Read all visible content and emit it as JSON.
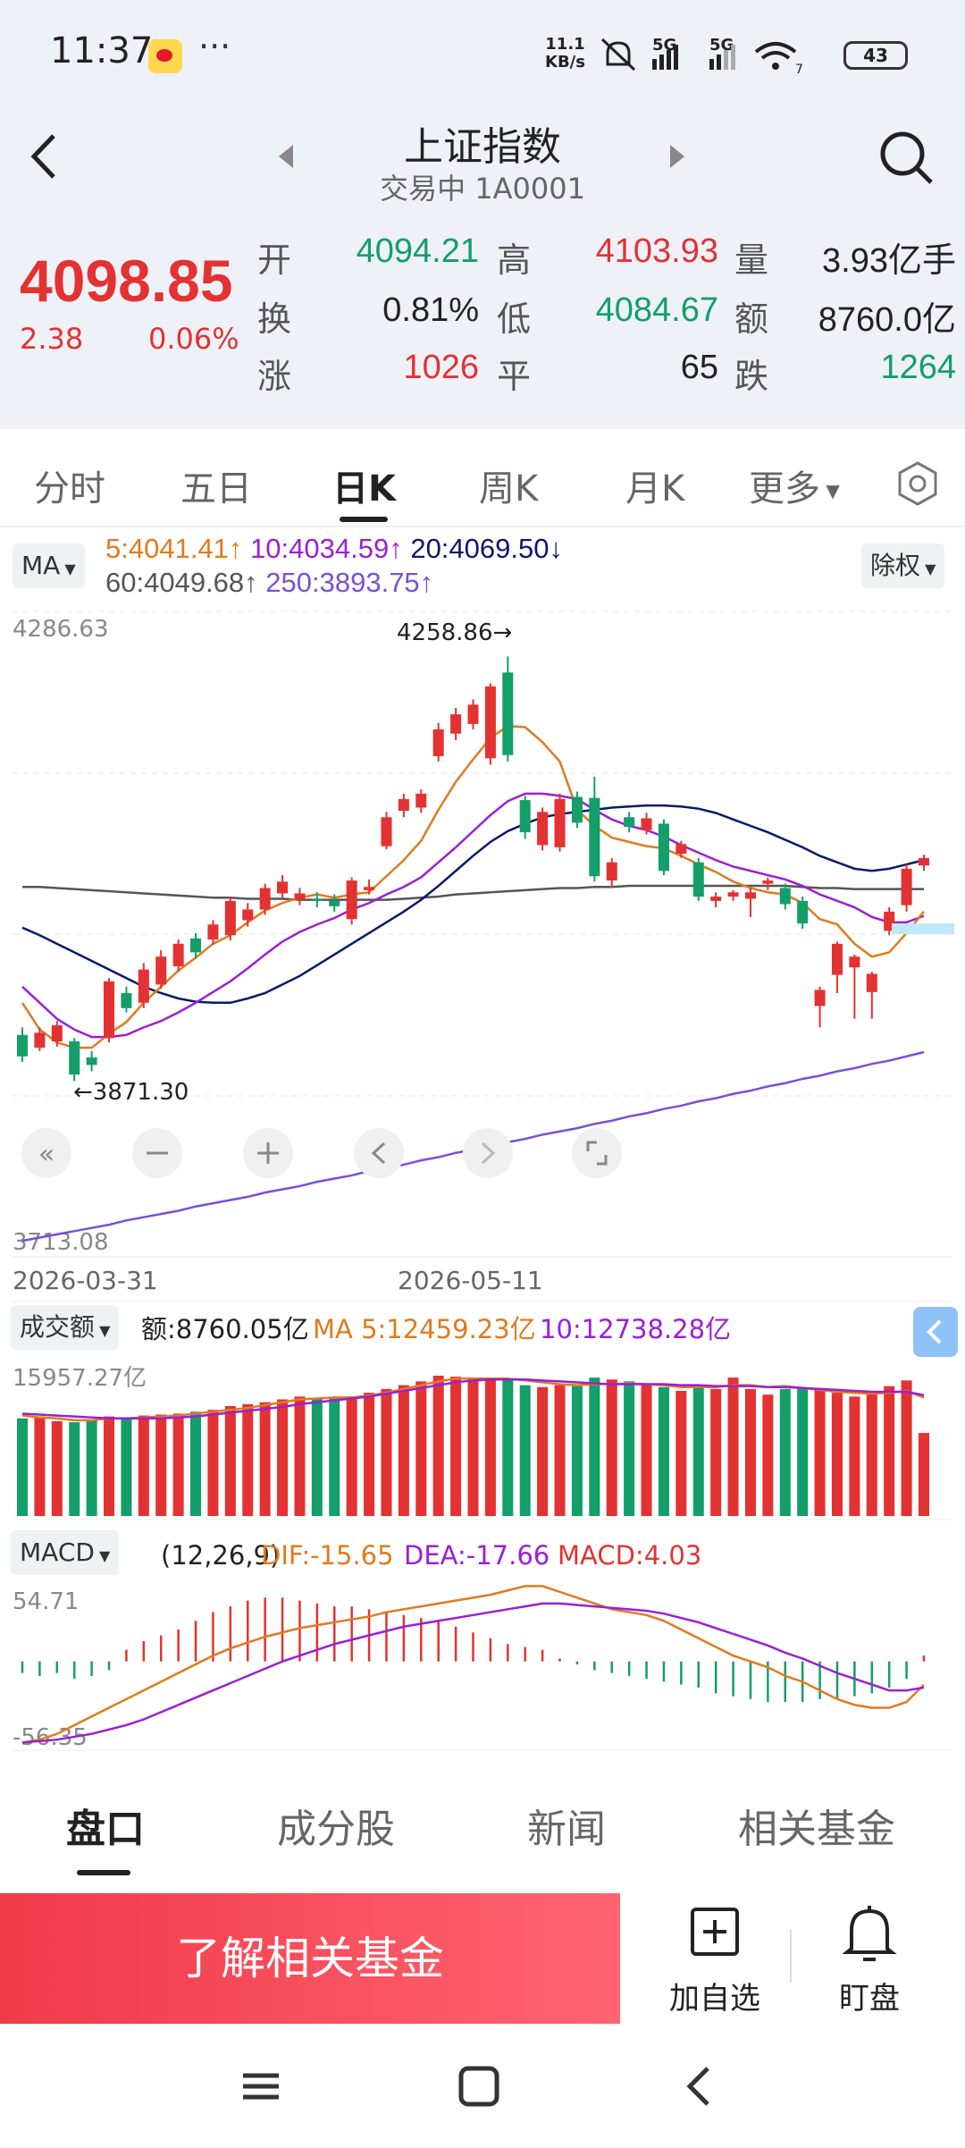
{
  "status": {
    "time": "11:37",
    "speed_top": "11.1",
    "speed_bottom": "KB/s",
    "net1": "5G",
    "net2": "5G",
    "wifi_sub": "7",
    "battery": "43",
    "more": "···"
  },
  "header": {
    "title": "上证指数",
    "subtitle": "交易中 1A0001"
  },
  "quote": {
    "price": "4098.85",
    "change": "2.38",
    "change_pct": "0.06%",
    "open_label": "开",
    "open": "4094.21",
    "high_label": "高",
    "high": "4103.93",
    "volume_label": "量",
    "volume": "3.93亿手",
    "turnover_label": "换",
    "turnover": "0.81%",
    "low_label": "低",
    "low": "4084.67",
    "amount_label": "额",
    "amount": "8760.0亿",
    "up_label": "涨",
    "up": "1026",
    "flat_label": "平",
    "flat": "65",
    "down_label": "跌",
    "down": "1264"
  },
  "period_tabs": [
    "分时",
    "五日",
    "日K",
    "周K",
    "月K",
    "更多"
  ],
  "ma": {
    "button": "MA",
    "ma5": "5:4041.41",
    "ma10": "10:4034.59",
    "ma20": "20:4069.50",
    "ma60": "60:4049.68",
    "ma250": "250:3893.75",
    "exright": "除权"
  },
  "kline": {
    "y_max_label": "4286.63",
    "y_min_label": "3713.08",
    "high_annot": "4258.86→",
    "low_annot": "←3871.30",
    "date_left": "2026-03-31",
    "date_mid": "2026-05-11"
  },
  "volume_panel": {
    "button": "成交额",
    "amount": "额:8760.05亿",
    "ma5": "MA 5:12459.23亿",
    "ma10": "10:12738.28亿",
    "y_max": "15957.27亿"
  },
  "macd_panel": {
    "button": "MACD",
    "params": "(12,26,9)",
    "dif": "DIF:-15.65",
    "dea": "DEA:-17.66",
    "macd": "MACD:4.03",
    "y_max": "54.71",
    "y_min": "-56.35"
  },
  "bottom_tabs": [
    "盘口",
    "成分股",
    "新闻",
    "相关基金"
  ],
  "actions": {
    "fund": "了解相关基金",
    "watch": "加自选",
    "alert": "盯盘"
  },
  "colors": {
    "up": "#e33232",
    "down": "#139e6a",
    "ma5": "#e07b1f",
    "ma10": "#9b1fd6",
    "ma20": "#0a1a6a",
    "ma60": "#555555",
    "ma250": "#7b4fd6"
  },
  "chart_data": {
    "type": "candlestick",
    "y_range": [
      3713.08,
      4286.63
    ],
    "candles": [
      {
        "o": 3905,
        "c": 3885,
        "h": 3912,
        "l": 3880
      },
      {
        "o": 3893,
        "c": 3907,
        "h": 3912,
        "l": 3890
      },
      {
        "o": 3899,
        "c": 3914,
        "h": 3918,
        "l": 3894
      },
      {
        "o": 3899,
        "c": 3868,
        "h": 3902,
        "l": 3862
      },
      {
        "o": 3884,
        "c": 3877,
        "h": 3890,
        "l": 3871
      },
      {
        "o": 3902,
        "c": 3955,
        "h": 3958,
        "l": 3898
      },
      {
        "o": 3944,
        "c": 3930,
        "h": 3950,
        "l": 3926
      },
      {
        "o": 3935,
        "c": 3966,
        "h": 3972,
        "l": 3930
      },
      {
        "o": 3952,
        "c": 3978,
        "h": 3984,
        "l": 3948
      },
      {
        "o": 3969,
        "c": 3990,
        "h": 3994,
        "l": 3964
      },
      {
        "o": 3995,
        "c": 3982,
        "h": 4000,
        "l": 3976
      },
      {
        "o": 3994,
        "c": 4008,
        "h": 4012,
        "l": 3989
      },
      {
        "o": 3998,
        "c": 4030,
        "h": 4034,
        "l": 3993
      },
      {
        "o": 4012,
        "c": 4022,
        "h": 4028,
        "l": 4006
      },
      {
        "o": 4022,
        "c": 4042,
        "h": 4046,
        "l": 4017
      },
      {
        "o": 4037,
        "c": 4048,
        "h": 4054,
        "l": 4031
      },
      {
        "o": 4031,
        "c": 4037,
        "h": 4042,
        "l": 4026
      },
      {
        "o": 4032,
        "c": 4030,
        "h": 4038,
        "l": 4024
      },
      {
        "o": 4030,
        "c": 4025,
        "h": 4036,
        "l": 4020
      },
      {
        "o": 4013,
        "c": 4049,
        "h": 4052,
        "l": 4008
      },
      {
        "o": 4040,
        "c": 4043,
        "h": 4050,
        "l": 4036
      },
      {
        "o": 4081,
        "c": 4108,
        "h": 4113,
        "l": 4078
      },
      {
        "o": 4114,
        "c": 4125,
        "h": 4130,
        "l": 4108
      },
      {
        "o": 4117,
        "c": 4130,
        "h": 4134,
        "l": 4112
      },
      {
        "o": 4165,
        "c": 4190,
        "h": 4196,
        "l": 4160
      },
      {
        "o": 4186,
        "c": 4204,
        "h": 4210,
        "l": 4180
      },
      {
        "o": 4195,
        "c": 4213,
        "h": 4218,
        "l": 4190
      },
      {
        "o": 4163,
        "c": 4230,
        "h": 4233,
        "l": 4157
      },
      {
        "o": 4243,
        "c": 4166,
        "h": 4258,
        "l": 4160
      },
      {
        "o": 4124,
        "c": 4094,
        "h": 4128,
        "l": 4088
      },
      {
        "o": 4082,
        "c": 4113,
        "h": 4117,
        "l": 4077
      },
      {
        "o": 4080,
        "c": 4125,
        "h": 4130,
        "l": 4076
      },
      {
        "o": 4127,
        "c": 4103,
        "h": 4132,
        "l": 4098
      },
      {
        "o": 4126,
        "c": 4053,
        "h": 4146,
        "l": 4048
      },
      {
        "o": 4049,
        "c": 4066,
        "h": 4070,
        "l": 4042
      },
      {
        "o": 4108,
        "c": 4099,
        "h": 4113,
        "l": 4094
      },
      {
        "o": 4096,
        "c": 4107,
        "h": 4112,
        "l": 4092
      },
      {
        "o": 4102,
        "c": 4058,
        "h": 4106,
        "l": 4054
      },
      {
        "o": 4074,
        "c": 4083,
        "h": 4086,
        "l": 4070
      },
      {
        "o": 4066,
        "c": 4034,
        "h": 4070,
        "l": 4030
      },
      {
        "o": 4030,
        "c": 4034,
        "h": 4038,
        "l": 4024
      },
      {
        "o": 4034,
        "c": 4038,
        "h": 4040,
        "l": 4030
      },
      {
        "o": 4032,
        "c": 4038,
        "h": 4042,
        "l": 4015
      },
      {
        "o": 4046,
        "c": 4049,
        "h": 4052,
        "l": 4040
      },
      {
        "o": 4042,
        "c": 4027,
        "h": 4046,
        "l": 4022
      },
      {
        "o": 4030,
        "c": 4009,
        "h": 4034,
        "l": 4004
      },
      {
        "o": 3932,
        "c": 3947,
        "h": 3950,
        "l": 3912
      },
      {
        "o": 3961,
        "c": 3990,
        "h": 3992,
        "l": 3944
      },
      {
        "o": 3968,
        "c": 3978,
        "h": 3980,
        "l": 3920
      },
      {
        "o": 3945,
        "c": 3962,
        "h": 3964,
        "l": 3920
      },
      {
        "o": 4002,
        "c": 4020,
        "h": 4024,
        "l": 3998
      },
      {
        "o": 4026,
        "c": 4060,
        "h": 4064,
        "l": 4020
      },
      {
        "o": 4063,
        "c": 4070,
        "h": 4073,
        "l": 4058
      }
    ],
    "ma_lines": {
      "ma5": [
        3935,
        3910,
        3898,
        3893,
        3893,
        3906,
        3917,
        3935,
        3950,
        3965,
        3977,
        3990,
        3998,
        4010,
        4021,
        4028,
        4033,
        4036,
        4033,
        4036,
        4038,
        4053,
        4068,
        4086,
        4115,
        4141,
        4162,
        4182,
        4193,
        4192,
        4178,
        4160,
        4115,
        4100,
        4089,
        4085,
        4081,
        4079,
        4072,
        4064,
        4057,
        4048,
        4042,
        4038,
        4036,
        4028,
        4013,
        4008,
        3990,
        3978,
        3982,
        4000,
        4020
      ],
      "ma10": [
        3950,
        3935,
        3920,
        3910,
        3903,
        3903,
        3905,
        3912,
        3918,
        3926,
        3935,
        3945,
        3955,
        3967,
        3980,
        3992,
        4001,
        4008,
        4014,
        4022,
        4028,
        4036,
        4043,
        4052,
        4066,
        4080,
        4095,
        4110,
        4123,
        4130,
        4130,
        4128,
        4125,
        4115,
        4106,
        4100,
        4096,
        4090,
        4082,
        4075,
        4068,
        4062,
        4058,
        4054,
        4050,
        4044,
        4036,
        4030,
        4024,
        4015,
        4010,
        4010,
        4016
      ],
      "ma20": [
        4005,
        3998,
        3990,
        3982,
        3974,
        3966,
        3958,
        3950,
        3944,
        3939,
        3936,
        3935,
        3935,
        3939,
        3944,
        3952,
        3960,
        3970,
        3980,
        3990,
        4000,
        4010,
        4020,
        4031,
        4044,
        4058,
        4072,
        4085,
        4095,
        4102,
        4108,
        4111,
        4113,
        4115,
        4117,
        4118,
        4119,
        4119,
        4118,
        4116,
        4112,
        4106,
        4100,
        4094,
        4087,
        4080,
        4072,
        4066,
        4060,
        4058,
        4060,
        4064,
        4068
      ],
      "ma60": [
        4043,
        4043,
        4042,
        4041,
        4040,
        4039,
        4038,
        4037,
        4036,
        4035,
        4034,
        4033,
        4033,
        4032,
        4032,
        4032,
        4031,
        4031,
        4031,
        4031,
        4031,
        4031,
        4032,
        4033,
        4034,
        4036,
        4037,
        4038,
        4039,
        4040,
        4041,
        4042,
        4042,
        4043,
        4043,
        4044,
        4044,
        4044,
        4044,
        4044,
        4044,
        4044,
        4044,
        4044,
        4044,
        4043,
        4042,
        4042,
        4041,
        4041,
        4041,
        4041,
        4041
      ],
      "ma250": [
        3713,
        3716,
        3719,
        3722,
        3725,
        3728,
        3732,
        3735,
        3738,
        3741,
        3745,
        3748,
        3751,
        3754,
        3758,
        3761,
        3764,
        3768,
        3771,
        3774,
        3778,
        3781,
        3784,
        3788,
        3791,
        3795,
        3798,
        3801,
        3805,
        3808,
        3812,
        3815,
        3818,
        3822,
        3825,
        3829,
        3832,
        3836,
        3839,
        3843,
        3846,
        3850,
        3853,
        3857,
        3860,
        3864,
        3867,
        3871,
        3874,
        3878,
        3881,
        3885,
        3889
      ]
    },
    "volume_max": 15957.27,
    "volume_scale_max": 19000,
    "volumes": [
      10300,
      10500,
      10000,
      9900,
      10200,
      10500,
      10400,
      10600,
      10700,
      10800,
      11000,
      11200,
      11600,
      11800,
      12000,
      12300,
      12600,
      12400,
      12500,
      12600,
      13000,
      13400,
      13800,
      14200,
      14800,
      14700,
      14400,
      14400,
      14400,
      13800,
      13600,
      13800,
      13700,
      14600,
      14400,
      14200,
      13800,
      13600,
      13200,
      13500,
      13400,
      14600,
      13400,
      12800,
      13400,
      13500,
      13300,
      13000,
      12600,
      12900,
      13700,
      14300,
      8760
    ],
    "volume_ma5": [
      10600,
      10400,
      10300,
      10100,
      10100,
      10300,
      10300,
      10400,
      10500,
      10600,
      10800,
      11000,
      11200,
      11400,
      11700,
      12000,
      12300,
      12400,
      12500,
      12500,
      12700,
      13000,
      13400,
      13800,
      14200,
      14500,
      14500,
      14500,
      14500,
      14300,
      14100,
      13900,
      13800,
      13900,
      13900,
      14000,
      13900,
      13800,
      13600,
      13600,
      13600,
      13800,
      13800,
      13600,
      13700,
      13500,
      13300,
      13100,
      13000,
      12900,
      13000,
      13200,
      12500
    ],
    "volume_ma10": [
      10800,
      10700,
      10600,
      10500,
      10400,
      10300,
      10300,
      10300,
      10300,
      10400,
      10500,
      10700,
      10900,
      11100,
      11300,
      11500,
      11800,
      12000,
      12200,
      12400,
      12600,
      12900,
      13200,
      13500,
      13800,
      14100,
      14300,
      14400,
      14400,
      14400,
      14300,
      14200,
      14100,
      14000,
      13900,
      13900,
      13900,
      13900,
      13800,
      13800,
      13700,
      13700,
      13700,
      13600,
      13600,
      13500,
      13400,
      13300,
      13200,
      13100,
      13100,
      13100,
      12740
    ],
    "macd_range": [
      -56.35,
      54.71
    ],
    "dif": [
      -56,
      -54,
      -50,
      -44,
      -38,
      -32,
      -26,
      -20,
      -14,
      -8,
      -2,
      4,
      9,
      13,
      17,
      20,
      23,
      25,
      27,
      29,
      31,
      34,
      36,
      38,
      40,
      42,
      44,
      46,
      49,
      52,
      52,
      48,
      44,
      40,
      36,
      34,
      32,
      28,
      22,
      16,
      10,
      4,
      0,
      -4,
      -10,
      -14,
      -20,
      -26,
      -30,
      -32,
      -32,
      -28,
      -16
    ],
    "dea": [
      -56,
      -55,
      -54,
      -52,
      -50,
      -47,
      -44,
      -40,
      -35,
      -30,
      -25,
      -20,
      -15,
      -10,
      -5,
      0,
      4,
      8,
      12,
      15,
      18,
      21,
      24,
      26,
      28,
      30,
      32,
      34,
      36,
      38,
      40,
      40,
      39,
      38,
      37,
      36,
      35,
      33,
      30,
      27,
      23,
      19,
      15,
      11,
      6,
      2,
      -3,
      -8,
      -12,
      -16,
      -20,
      -20,
      -18
    ],
    "macd_hist": [
      -8,
      -10,
      -8,
      -12,
      -10,
      -6,
      8,
      14,
      18,
      22,
      28,
      34,
      38,
      42,
      44,
      44,
      42,
      40,
      38,
      38,
      36,
      34,
      32,
      30,
      28,
      24,
      20,
      16,
      12,
      10,
      8,
      2,
      -2,
      -6,
      -8,
      -10,
      -12,
      -14,
      -16,
      -18,
      -22,
      -24,
      -26,
      -28,
      -28,
      -28,
      -26,
      -26,
      -24,
      -22,
      -18,
      -12,
      4
    ]
  }
}
